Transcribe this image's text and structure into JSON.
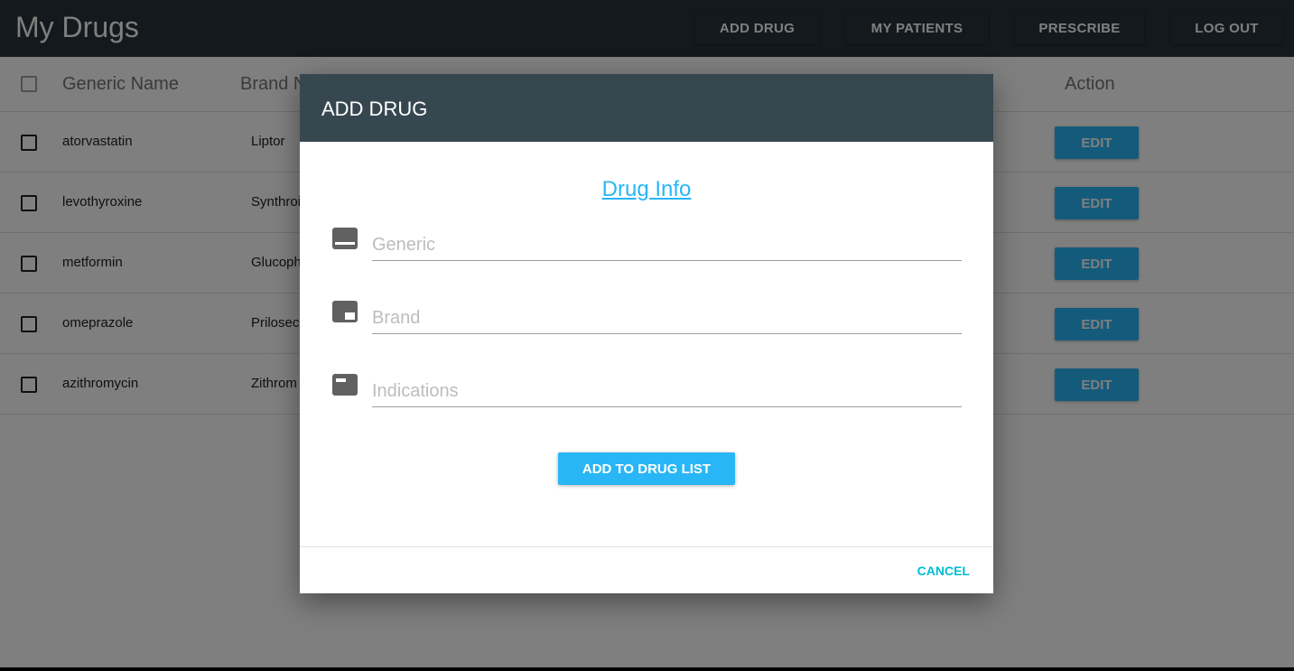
{
  "app": {
    "title": "My Drugs",
    "nav": [
      "ADD DRUG",
      "MY PATIENTS",
      "PRESCRIBE",
      "LOG OUT"
    ]
  },
  "table": {
    "headers": {
      "generic": "Generic Name",
      "brand": "Brand N",
      "action": "Action"
    },
    "rows": [
      {
        "generic": "atorvastatin",
        "brand": "Liptor",
        "action": "EDIT"
      },
      {
        "generic": "levothyroxine",
        "brand": "Synthroi",
        "action": "EDIT"
      },
      {
        "generic": "metformin",
        "brand": "Glucoph",
        "action": "EDIT"
      },
      {
        "generic": "omeprazole",
        "brand": "Prilosec",
        "action": "EDIT"
      },
      {
        "generic": "azithromycin",
        "brand": "Zithrom",
        "action": "EDIT"
      }
    ]
  },
  "dialog": {
    "title": "ADD DRUG",
    "section_title": "Drug Info",
    "fields": [
      {
        "placeholder": "Generic",
        "value": "",
        "icon": "subtitles-icon"
      },
      {
        "placeholder": "Brand",
        "value": "",
        "icon": "picture-in-picture-icon"
      },
      {
        "placeholder": "Indications",
        "value": "",
        "icon": "label-icon"
      }
    ],
    "submit_label": "ADD TO DRUG LIST",
    "cancel_label": "CANCEL"
  },
  "colors": {
    "appbar": "#263238",
    "dialog_header": "#37474f",
    "accent": "#29b6f6",
    "cancel": "#00bcd4"
  }
}
